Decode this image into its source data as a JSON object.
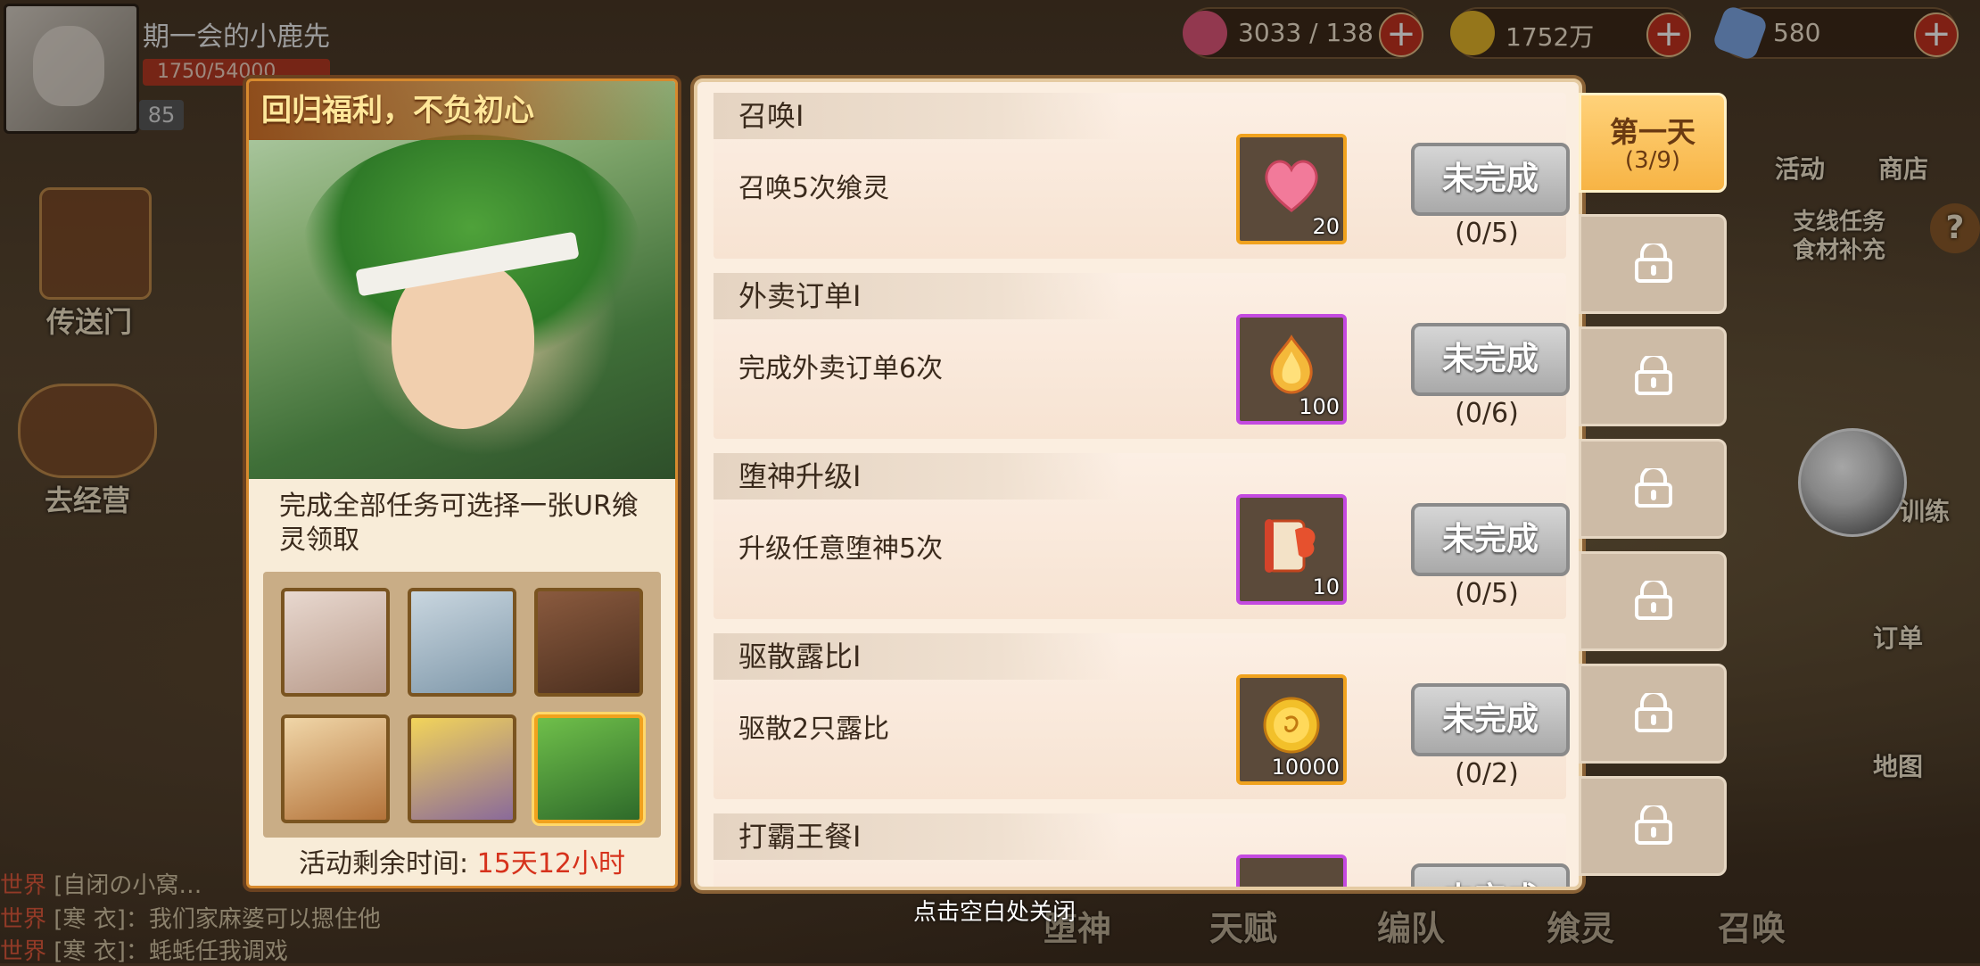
{
  "top_bar": {
    "player_name": "期一会的小鹿先",
    "exp_text": "1750/54000",
    "level": "85",
    "resources": [
      {
        "icon": "heart-icon",
        "value": "3033 / 138"
      },
      {
        "icon": "coin-icon",
        "value": "1752万"
      },
      {
        "icon": "crystal-icon",
        "value": "580"
      }
    ],
    "plus": "+"
  },
  "left_side": {
    "portal": "传送门",
    "go_business": "去经营"
  },
  "right_side": {
    "activity": "活动",
    "shop": "商店",
    "side_quest_line1": "支线任务",
    "side_quest_line2": "食材补充",
    "help": "?",
    "training": "训练",
    "orders": "订单",
    "map": "地图"
  },
  "chat": [
    {
      "tag": "世界",
      "text": "[自闭の小窝…"
    },
    {
      "tag": "世界",
      "text": "[寒 衣]：我们家麻婆可以摁住他"
    },
    {
      "tag": "世界",
      "text": "[寒 衣]：蚝蚝任我调戏"
    }
  ],
  "bottom_nav": [
    "堕神",
    "天赋",
    "编队",
    "飨灵",
    "召唤"
  ],
  "left_card": {
    "banner_title": "回归福利，不负初心",
    "description": "完成全部任务可选择一张UR飨灵领取",
    "remaining_label": "活动剩余时间: ",
    "remaining_value": "15天12小时"
  },
  "tasks": [
    {
      "title": "召唤I",
      "desc": "召唤5次飨灵",
      "reward_icon": "heart-item-icon",
      "reward_qty": "20",
      "frame": "orange",
      "status": "未完成",
      "progress": "(0/5)"
    },
    {
      "title": "外卖订单I",
      "desc": "完成外卖订单6次",
      "reward_icon": "flame-bulb-icon",
      "reward_qty": "100",
      "frame": "purple",
      "status": "未完成",
      "progress": "(0/6)"
    },
    {
      "title": "堕神升级I",
      "desc": "升级任意堕神5次",
      "reward_icon": "scroll-icon",
      "reward_qty": "10",
      "frame": "purple",
      "status": "未完成",
      "progress": "(0/5)"
    },
    {
      "title": "驱散露比I",
      "desc": "驱散2只露比",
      "reward_icon": "gold-coin-icon",
      "reward_qty": "10000",
      "frame": "orange",
      "status": "未完成",
      "progress": "(0/2)"
    },
    {
      "title": "打霸王餐I",
      "desc": "",
      "reward_icon": "slime-icon",
      "reward_qty": "",
      "frame": "purple",
      "status": "未完成",
      "progress": ""
    }
  ],
  "day_tabs": {
    "active_label": "第一天",
    "active_progress": "(3/9)"
  },
  "close_hint": "点击空白处关闭",
  "colors": {
    "accent_orange": "#f7b445",
    "deadline_red": "#d6321c",
    "panel_bg": "#fbeee0"
  }
}
